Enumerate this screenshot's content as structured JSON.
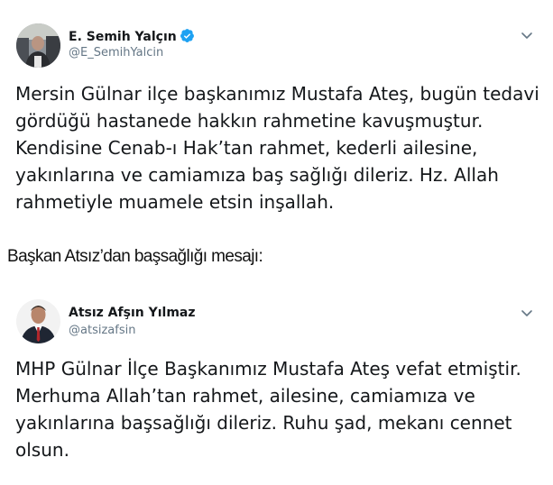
{
  "tweets": [
    {
      "display_name": "E. Semih Yalçın",
      "handle": "@E_SemihYalcin",
      "verified": true,
      "verified_icon": "verified-badge-icon",
      "menu_icon": "chevron-down-icon",
      "text": "Mersin Gülnar ilçe başkanımız Mustafa Ateş, bugün tedavi gördüğü hastanede hakkın rahmetine kavuşmuştur. Kendisine Cenab-ı Hak’tan rahmet, kederli ailesine, yakınlarına ve camiamıza baş sağlığı dileriz. Hz. Allah rahmetiyle muamele etsin inşallah."
    },
    {
      "display_name": "Atsız Afşın Yılmaz",
      "handle": "@atsizafsin",
      "verified": false,
      "menu_icon": "chevron-down-icon",
      "text": "MHP Gülnar İlçe Başkanımız Mustafa Ateş vefat etmiştir. Merhuma Allah’tan rahmet, ailesine, camiamıza ve yakınlarına başsağlığı dileriz. Ruhu şad, mekanı cennet olsun."
    }
  ],
  "caption": "Başkan Atsız’dan başsağlığı mesajı:",
  "colors": {
    "text": "#14171a",
    "secondary": "#657786",
    "verified": "#1da1f2"
  }
}
